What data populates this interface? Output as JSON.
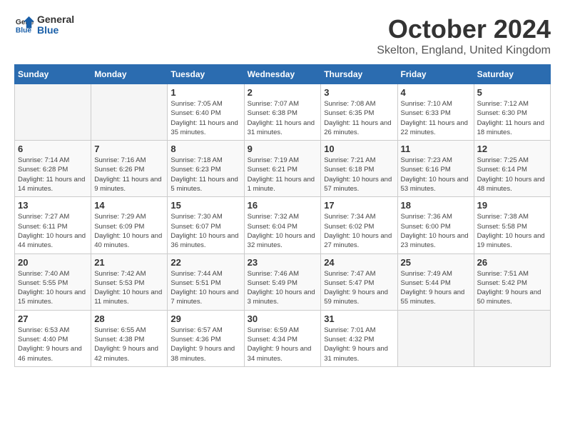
{
  "header": {
    "logo_line1": "General",
    "logo_line2": "Blue",
    "month": "October 2024",
    "location": "Skelton, England, United Kingdom"
  },
  "weekdays": [
    "Sunday",
    "Monday",
    "Tuesday",
    "Wednesday",
    "Thursday",
    "Friday",
    "Saturday"
  ],
  "weeks": [
    [
      {
        "day": "",
        "info": ""
      },
      {
        "day": "",
        "info": ""
      },
      {
        "day": "1",
        "info": "Sunrise: 7:05 AM\nSunset: 6:40 PM\nDaylight: 11 hours and 35 minutes."
      },
      {
        "day": "2",
        "info": "Sunrise: 7:07 AM\nSunset: 6:38 PM\nDaylight: 11 hours and 31 minutes."
      },
      {
        "day": "3",
        "info": "Sunrise: 7:08 AM\nSunset: 6:35 PM\nDaylight: 11 hours and 26 minutes."
      },
      {
        "day": "4",
        "info": "Sunrise: 7:10 AM\nSunset: 6:33 PM\nDaylight: 11 hours and 22 minutes."
      },
      {
        "day": "5",
        "info": "Sunrise: 7:12 AM\nSunset: 6:30 PM\nDaylight: 11 hours and 18 minutes."
      }
    ],
    [
      {
        "day": "6",
        "info": "Sunrise: 7:14 AM\nSunset: 6:28 PM\nDaylight: 11 hours and 14 minutes."
      },
      {
        "day": "7",
        "info": "Sunrise: 7:16 AM\nSunset: 6:26 PM\nDaylight: 11 hours and 9 minutes."
      },
      {
        "day": "8",
        "info": "Sunrise: 7:18 AM\nSunset: 6:23 PM\nDaylight: 11 hours and 5 minutes."
      },
      {
        "day": "9",
        "info": "Sunrise: 7:19 AM\nSunset: 6:21 PM\nDaylight: 11 hours and 1 minute."
      },
      {
        "day": "10",
        "info": "Sunrise: 7:21 AM\nSunset: 6:18 PM\nDaylight: 10 hours and 57 minutes."
      },
      {
        "day": "11",
        "info": "Sunrise: 7:23 AM\nSunset: 6:16 PM\nDaylight: 10 hours and 53 minutes."
      },
      {
        "day": "12",
        "info": "Sunrise: 7:25 AM\nSunset: 6:14 PM\nDaylight: 10 hours and 48 minutes."
      }
    ],
    [
      {
        "day": "13",
        "info": "Sunrise: 7:27 AM\nSunset: 6:11 PM\nDaylight: 10 hours and 44 minutes."
      },
      {
        "day": "14",
        "info": "Sunrise: 7:29 AM\nSunset: 6:09 PM\nDaylight: 10 hours and 40 minutes."
      },
      {
        "day": "15",
        "info": "Sunrise: 7:30 AM\nSunset: 6:07 PM\nDaylight: 10 hours and 36 minutes."
      },
      {
        "day": "16",
        "info": "Sunrise: 7:32 AM\nSunset: 6:04 PM\nDaylight: 10 hours and 32 minutes."
      },
      {
        "day": "17",
        "info": "Sunrise: 7:34 AM\nSunset: 6:02 PM\nDaylight: 10 hours and 27 minutes."
      },
      {
        "day": "18",
        "info": "Sunrise: 7:36 AM\nSunset: 6:00 PM\nDaylight: 10 hours and 23 minutes."
      },
      {
        "day": "19",
        "info": "Sunrise: 7:38 AM\nSunset: 5:58 PM\nDaylight: 10 hours and 19 minutes."
      }
    ],
    [
      {
        "day": "20",
        "info": "Sunrise: 7:40 AM\nSunset: 5:55 PM\nDaylight: 10 hours and 15 minutes."
      },
      {
        "day": "21",
        "info": "Sunrise: 7:42 AM\nSunset: 5:53 PM\nDaylight: 10 hours and 11 minutes."
      },
      {
        "day": "22",
        "info": "Sunrise: 7:44 AM\nSunset: 5:51 PM\nDaylight: 10 hours and 7 minutes."
      },
      {
        "day": "23",
        "info": "Sunrise: 7:46 AM\nSunset: 5:49 PM\nDaylight: 10 hours and 3 minutes."
      },
      {
        "day": "24",
        "info": "Sunrise: 7:47 AM\nSunset: 5:47 PM\nDaylight: 9 hours and 59 minutes."
      },
      {
        "day": "25",
        "info": "Sunrise: 7:49 AM\nSunset: 5:44 PM\nDaylight: 9 hours and 55 minutes."
      },
      {
        "day": "26",
        "info": "Sunrise: 7:51 AM\nSunset: 5:42 PM\nDaylight: 9 hours and 50 minutes."
      }
    ],
    [
      {
        "day": "27",
        "info": "Sunrise: 6:53 AM\nSunset: 4:40 PM\nDaylight: 9 hours and 46 minutes."
      },
      {
        "day": "28",
        "info": "Sunrise: 6:55 AM\nSunset: 4:38 PM\nDaylight: 9 hours and 42 minutes."
      },
      {
        "day": "29",
        "info": "Sunrise: 6:57 AM\nSunset: 4:36 PM\nDaylight: 9 hours and 38 minutes."
      },
      {
        "day": "30",
        "info": "Sunrise: 6:59 AM\nSunset: 4:34 PM\nDaylight: 9 hours and 34 minutes."
      },
      {
        "day": "31",
        "info": "Sunrise: 7:01 AM\nSunset: 4:32 PM\nDaylight: 9 hours and 31 minutes."
      },
      {
        "day": "",
        "info": ""
      },
      {
        "day": "",
        "info": ""
      }
    ]
  ]
}
